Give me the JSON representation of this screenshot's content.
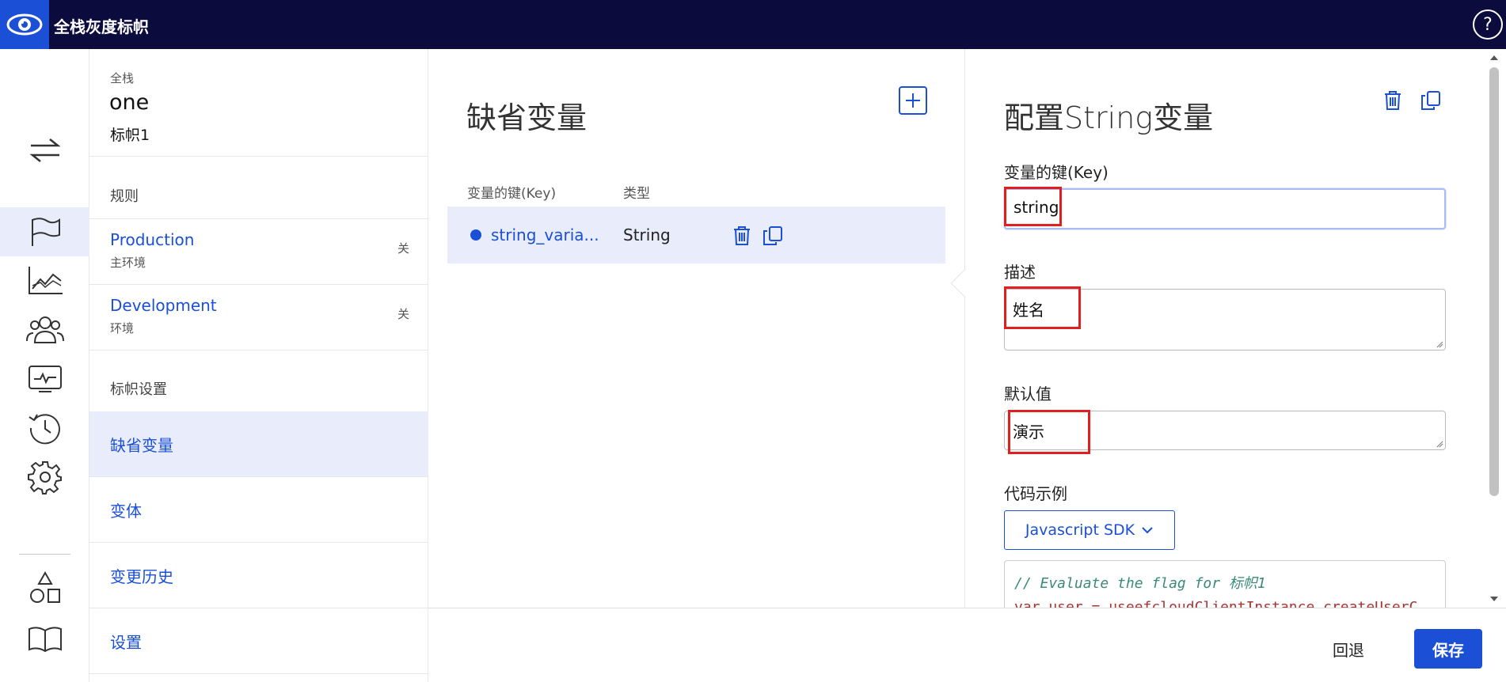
{
  "app": {
    "title": "全栈灰度标帜",
    "help_label": "?"
  },
  "nav": {
    "crumb": "全栈",
    "flag_key": "one",
    "flag_name": "标帜1",
    "rules_heading": "规则",
    "environments": [
      {
        "name": "Production",
        "sub": "主环境",
        "state": "关"
      },
      {
        "name": "Development",
        "sub": "环境",
        "state": "关"
      }
    ],
    "settings_heading": "标帜设置",
    "items": [
      "缺省变量",
      "变体",
      "变更历史",
      "设置"
    ]
  },
  "main": {
    "title": "缺省变量",
    "columns": {
      "key": "变量的键(Key)",
      "type": "类型"
    },
    "rows": [
      {
        "key": "string_varia...",
        "type": "String"
      }
    ]
  },
  "panel": {
    "title": "配置String变量",
    "key_label": "变量的键(Key)",
    "key_value": "string",
    "desc_label": "描述",
    "desc_value": "姓名",
    "default_label": "默认值",
    "default_value": "演示",
    "code_label": "代码示例",
    "sdk_label": "Javascript SDK",
    "code_line1": "// Evaluate the flag for 标帜1",
    "code_line2": "var user = useefcloudClientInstance.createUserC"
  },
  "footer": {
    "cancel": "回退",
    "save": "保存"
  },
  "colors": {
    "accent": "#1a4fd6",
    "topbar": "#0b0c3d",
    "highlight": "#e9ecfb",
    "annotation": "#e02020"
  },
  "icons": [
    "eye-logo-icon",
    "help-icon",
    "switch-arrows-icon",
    "flag-icon",
    "chart-icon",
    "users-icon",
    "monitor-icon",
    "history-icon",
    "gear-icon",
    "shapes-icon",
    "book-icon",
    "plus-icon",
    "trash-icon",
    "copy-icon",
    "chevron-down-icon"
  ]
}
